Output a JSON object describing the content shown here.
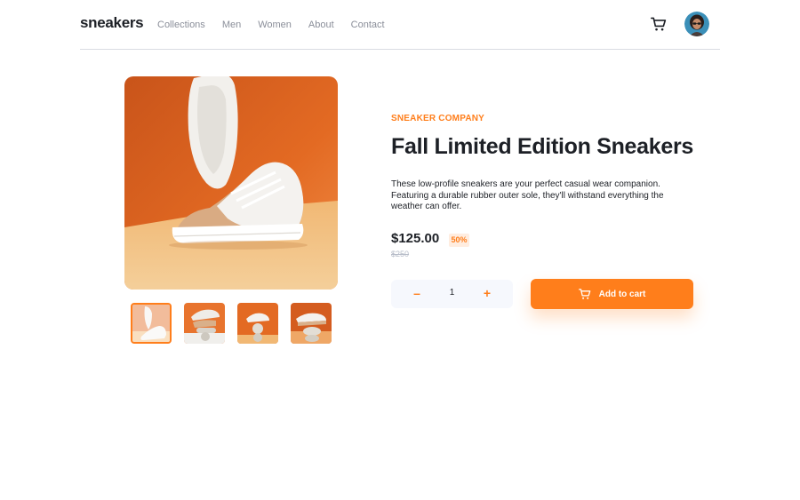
{
  "header": {
    "logo": "sneakers",
    "nav": [
      "Collections",
      "Men",
      "Women",
      "About",
      "Contact"
    ]
  },
  "product": {
    "company": "SNEAKER COMPANY",
    "title": "Fall Limited Edition Sneakers",
    "description": "These low-profile sneakers are your perfect casual wear companion. Featuring a durable rubber outer sole, they'll withstand everything the weather can offer.",
    "price": "$125.00",
    "discount": "50%",
    "old_price": "$250",
    "quantity": "1",
    "decrement_symbol": "–",
    "increment_symbol": "+",
    "add_to_cart_label": "Add to cart"
  },
  "icons": {
    "cart": "cart-icon",
    "avatar": "user-avatar"
  },
  "colors": {
    "accent": "#ff7e1b",
    "accent_light": "#ffede0",
    "text_dark": "#1d2026",
    "text_muted": "#8a8e99",
    "qty_bg": "#f6f8fd"
  }
}
